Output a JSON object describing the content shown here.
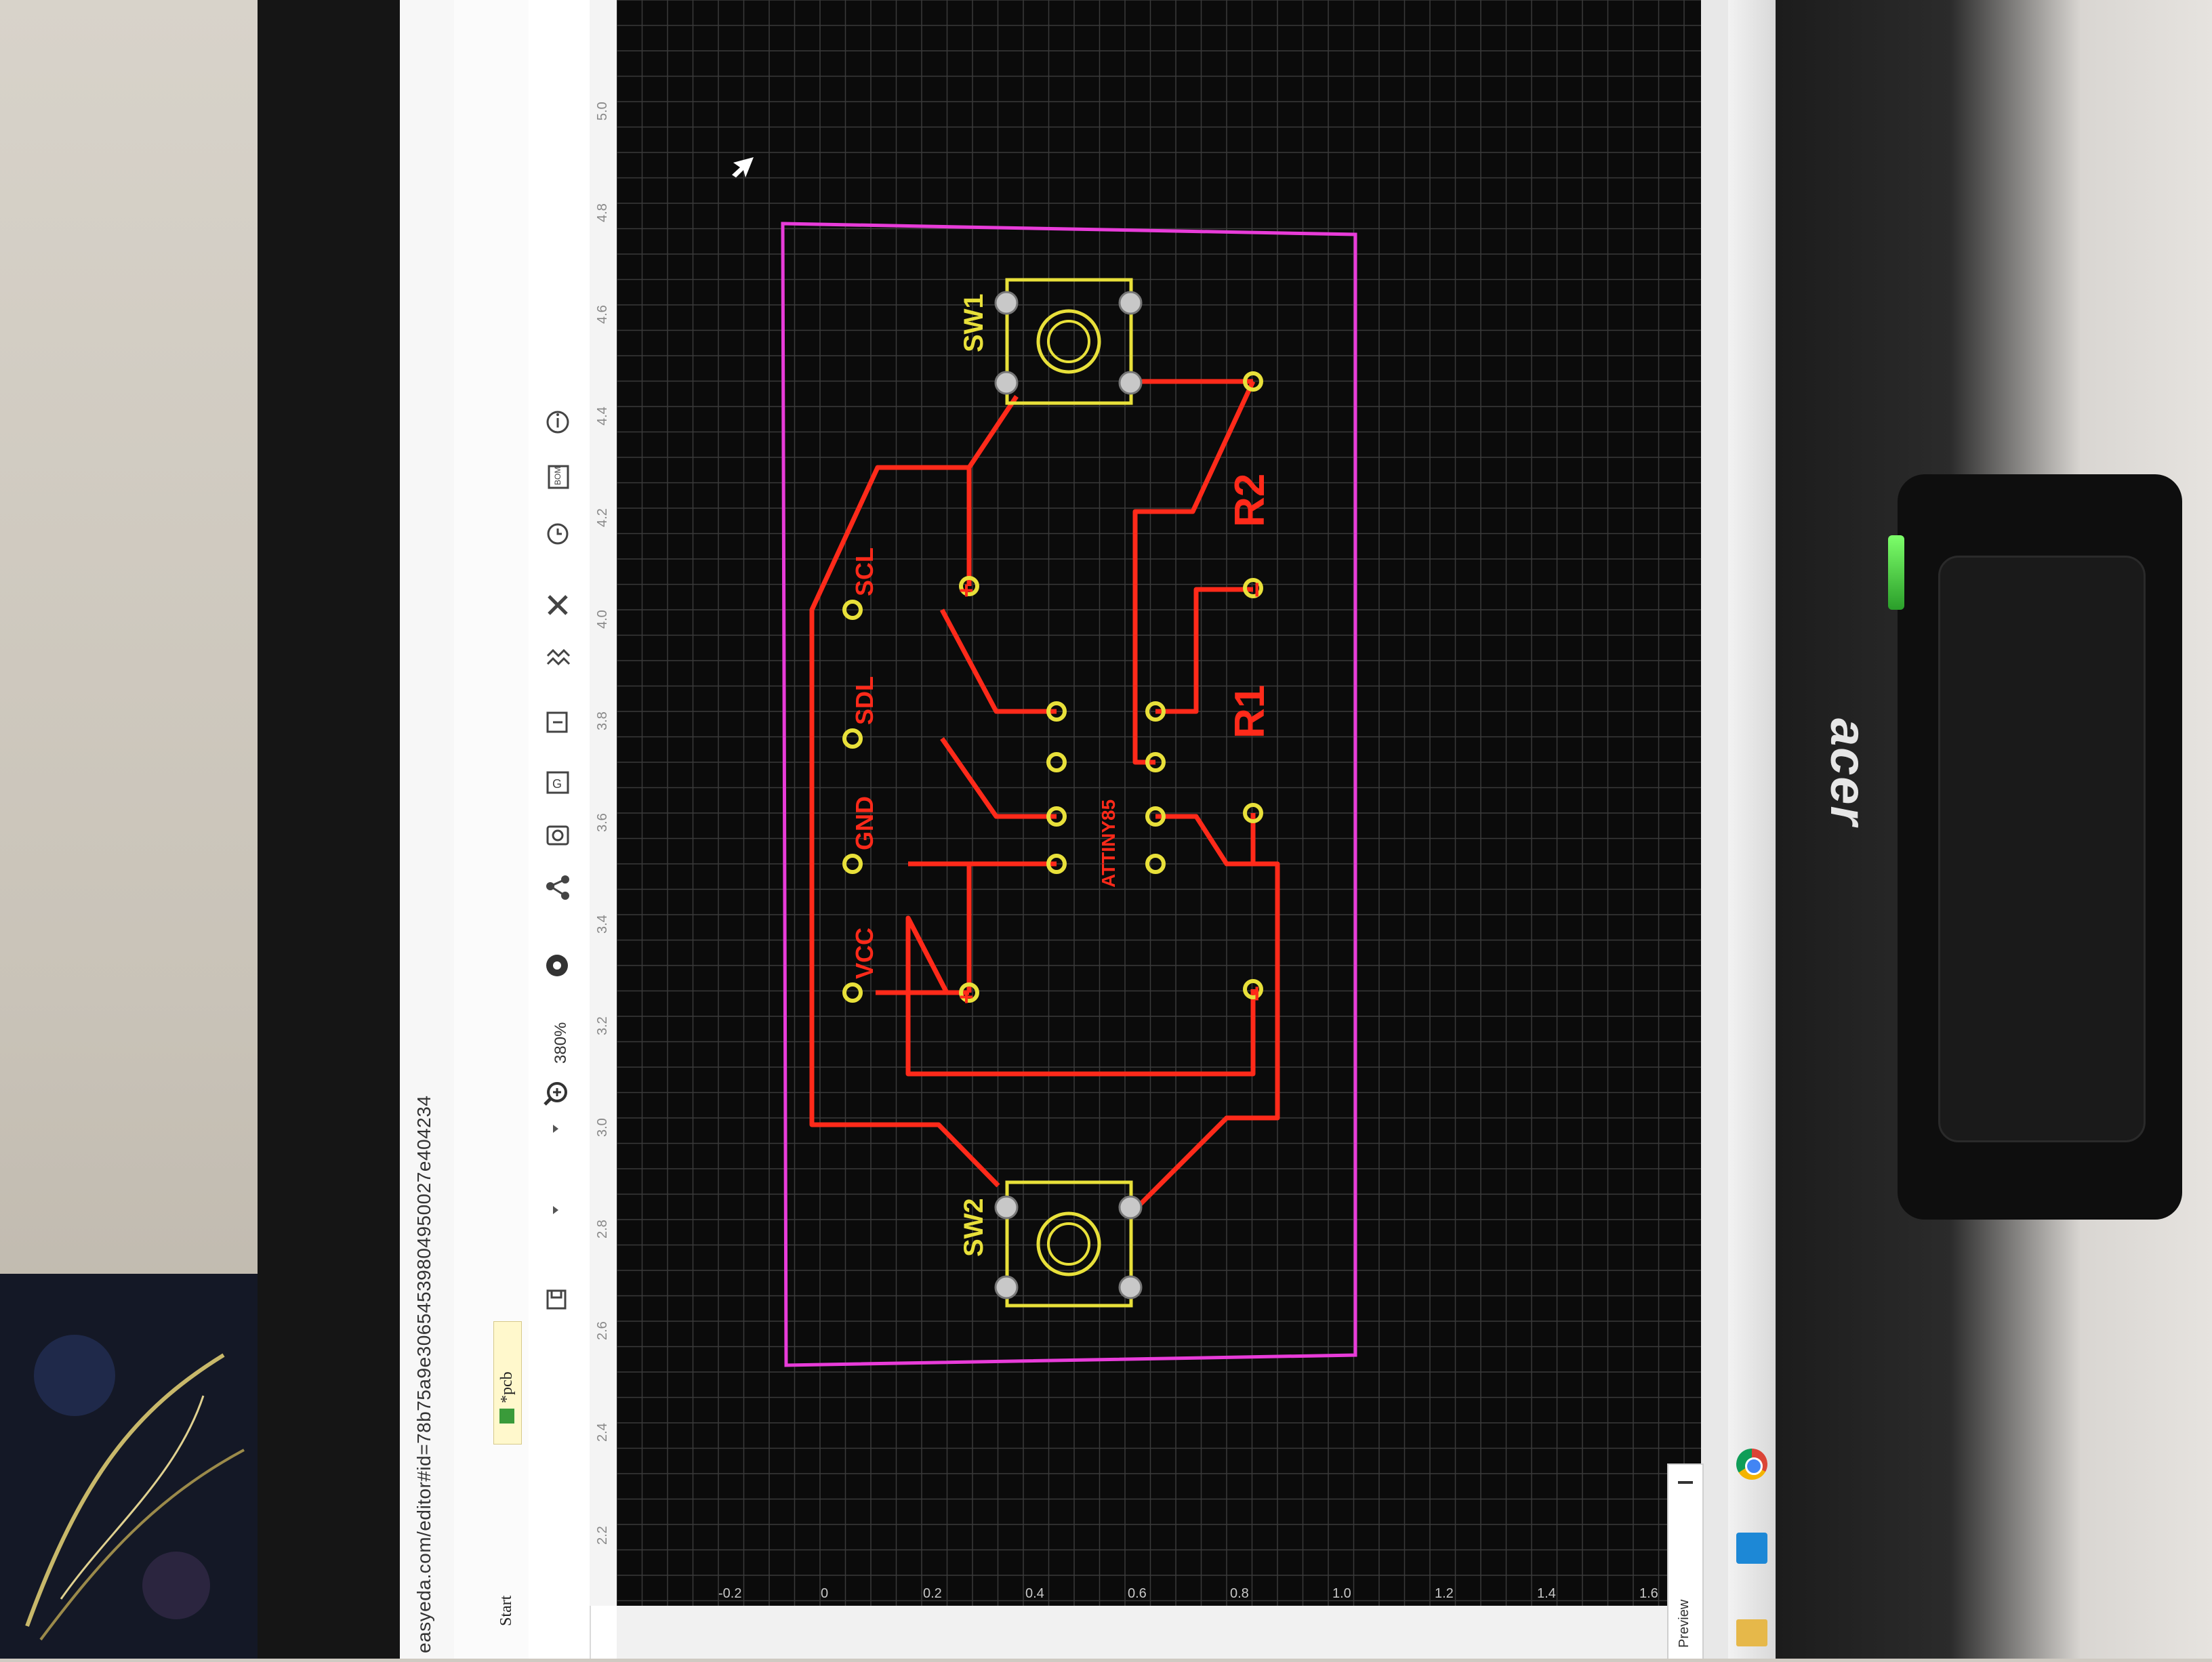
{
  "browser": {
    "url": "easyeda.com/editor#id=78b75a9e30654539804950027e404234"
  },
  "editor": {
    "tabs": [
      {
        "label": "Start"
      },
      {
        "label": "*pcb"
      }
    ],
    "zoom": "380%",
    "toolbar_icons": [
      "save-icon",
      "dropdown-arrow",
      "zoom-icon",
      "settings-icon",
      "share-icon",
      "camera-icon",
      "gerber-icon",
      "import-icon",
      "layers-icon",
      "tools-icon",
      "history-icon",
      "bom-icon",
      "info-icon"
    ],
    "top_ruler_labels": [
      "2.2",
      "2.4",
      "2.6",
      "2.8",
      "3.0",
      "3.2",
      "3.4",
      "3.6",
      "3.8",
      "4.0",
      "4.2",
      "4.4",
      "4.6",
      "4.8",
      "5.0"
    ],
    "bottom_ruler_labels": [
      "-0.2",
      "0",
      "0.2",
      "0.4",
      "0.6",
      "0.8",
      "1.0",
      "1.2",
      "1.4",
      "1.6"
    ],
    "preview_label": "Preview",
    "bom_label": "BOM"
  },
  "pcb": {
    "components": {
      "sw1": "SW1",
      "sw2": "SW2",
      "r1": "R1",
      "r2": "R2",
      "ic": "ATTINY85"
    },
    "header_pins": [
      "VCC",
      "GND",
      "SDL",
      "SCL"
    ],
    "polarity": {
      "plus": "+",
      "minus": "−"
    },
    "colors": {
      "background": "#0b0b0b",
      "grid": "#3a3a3a",
      "outline": "#e83cd9",
      "trace": "#ff2a1a",
      "silk": "#e8e03a",
      "pad": "#e8e03a"
    }
  },
  "monitor": {
    "brand": "acer"
  },
  "taskbar": {
    "icons": [
      "chrome-icon",
      "app-icon",
      "folder-icon"
    ]
  }
}
